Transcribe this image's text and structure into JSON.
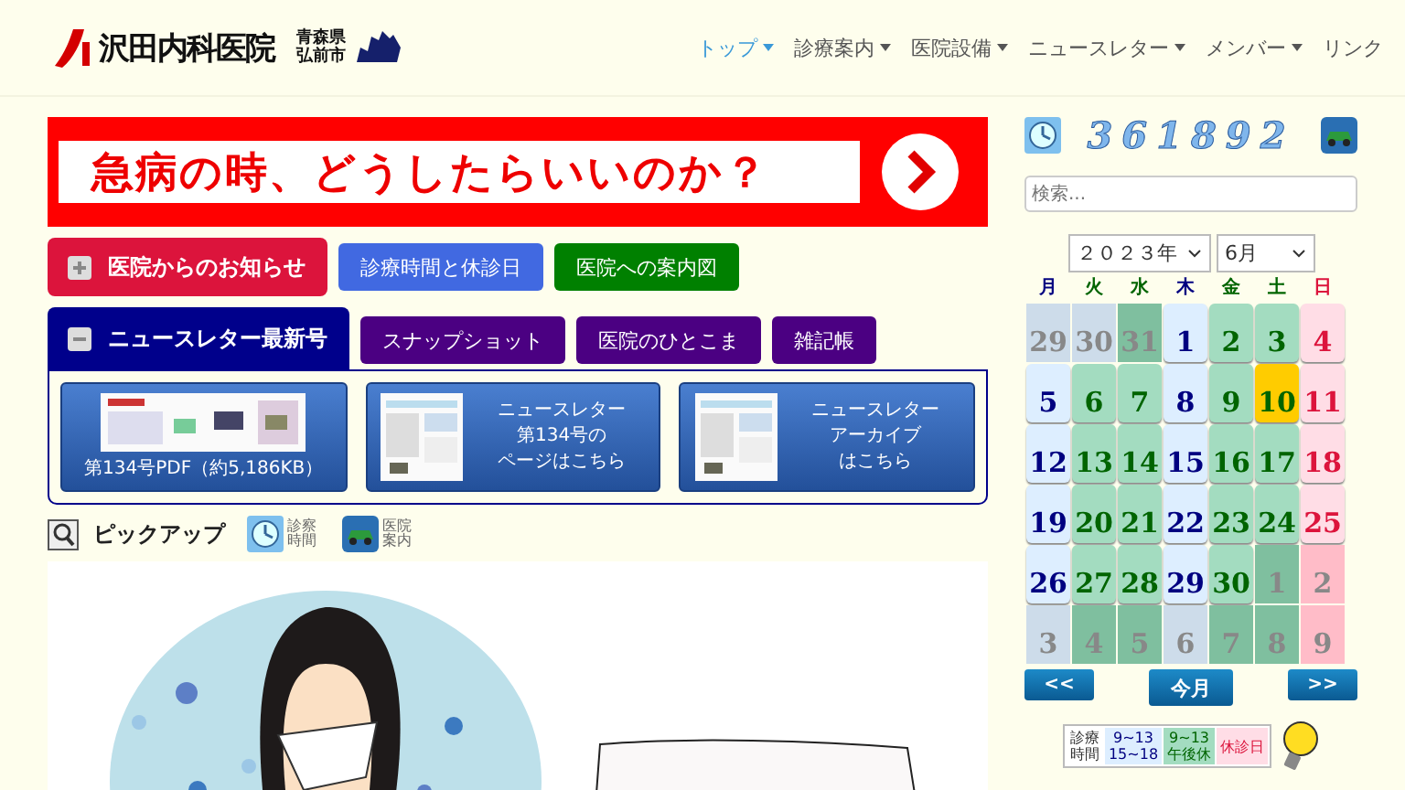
{
  "header": {
    "logo": "沢田内科医院",
    "region": [
      "青森県",
      "弘前市"
    ],
    "nav": [
      {
        "label": "トップ",
        "selected": true,
        "dropdown": true
      },
      {
        "label": "診療案内",
        "selected": false,
        "dropdown": true
      },
      {
        "label": "医院設備",
        "selected": false,
        "dropdown": true
      },
      {
        "label": "ニュースレター",
        "selected": false,
        "dropdown": true
      },
      {
        "label": "メンバー",
        "selected": false,
        "dropdown": true
      },
      {
        "label": "リンク",
        "selected": false,
        "dropdown": false
      }
    ]
  },
  "banner": {
    "text": "急病の時、どうしたらいいのか？"
  },
  "tab_groups": [
    {
      "main": {
        "label": "医院からのお知らせ",
        "expanded": false,
        "color": "#dc143c"
      },
      "links": [
        {
          "label": "診療時間と休診日",
          "color": "#4169e1"
        },
        {
          "label": "医院への案内図",
          "color": "#008000"
        }
      ]
    },
    {
      "main": {
        "label": "ニュースレター最新号",
        "expanded": true,
        "color": "#00008b"
      },
      "links": [
        {
          "label": "スナップショット",
          "color": "#4b0082"
        },
        {
          "label": "医院のひとこま",
          "color": "#4b0082"
        },
        {
          "label": "雑記帳",
          "color": "#4b0082"
        }
      ]
    }
  ],
  "newsletter": [
    {
      "kind": "wide",
      "lines": [
        "第134号PDF（約5,186KB）"
      ]
    },
    {
      "kind": "side",
      "lines": [
        "ニュースレター",
        "第134号の",
        "ページはこちら"
      ]
    },
    {
      "kind": "side",
      "lines": [
        "ニュースレター",
        "アーカイブ",
        "はこちら"
      ]
    }
  ],
  "pickup": {
    "title": "ピックアップ",
    "links": [
      {
        "kind": "clock",
        "lines": [
          "診察",
          "時間"
        ]
      },
      {
        "kind": "car",
        "lines": [
          "医院",
          "案内"
        ]
      }
    ]
  },
  "sidebar": {
    "counter": "361892",
    "search": {
      "placeholder": "検索..."
    },
    "year": "２０２３年",
    "month": "6月",
    "weekdays": [
      {
        "label": "月",
        "color": "#000080"
      },
      {
        "label": "火",
        "color": "#006400"
      },
      {
        "label": "水",
        "color": "#006400"
      },
      {
        "label": "木",
        "color": "#000080"
      },
      {
        "label": "金",
        "color": "#006400"
      },
      {
        "label": "土",
        "color": "#006400"
      },
      {
        "label": "日",
        "color": "#dc143c"
      }
    ],
    "days": [
      {
        "day": "29",
        "kind": "full",
        "other_month": true,
        "today": false
      },
      {
        "day": "30",
        "kind": "full",
        "other_month": true,
        "today": false
      },
      {
        "day": "31",
        "kind": "half",
        "other_month": true,
        "today": false
      },
      {
        "day": "1",
        "kind": "full",
        "other_month": false,
        "today": false
      },
      {
        "day": "2",
        "kind": "half",
        "other_month": false,
        "today": false
      },
      {
        "day": "3",
        "kind": "half",
        "other_month": false,
        "today": false
      },
      {
        "day": "4",
        "kind": "closed",
        "other_month": false,
        "today": false
      },
      {
        "day": "5",
        "kind": "full",
        "other_month": false,
        "today": false
      },
      {
        "day": "6",
        "kind": "half",
        "other_month": false,
        "today": false
      },
      {
        "day": "7",
        "kind": "half",
        "other_month": false,
        "today": false
      },
      {
        "day": "8",
        "kind": "full",
        "other_month": false,
        "today": false
      },
      {
        "day": "9",
        "kind": "half",
        "other_month": false,
        "today": false
      },
      {
        "day": "10",
        "kind": "half",
        "other_month": false,
        "today": true
      },
      {
        "day": "11",
        "kind": "closed",
        "other_month": false,
        "today": false
      },
      {
        "day": "12",
        "kind": "full",
        "other_month": false,
        "today": false
      },
      {
        "day": "13",
        "kind": "half",
        "other_month": false,
        "today": false
      },
      {
        "day": "14",
        "kind": "half",
        "other_month": false,
        "today": false
      },
      {
        "day": "15",
        "kind": "full",
        "other_month": false,
        "today": false
      },
      {
        "day": "16",
        "kind": "half",
        "other_month": false,
        "today": false
      },
      {
        "day": "17",
        "kind": "half",
        "other_month": false,
        "today": false
      },
      {
        "day": "18",
        "kind": "closed",
        "other_month": false,
        "today": false
      },
      {
        "day": "19",
        "kind": "full",
        "other_month": false,
        "today": false
      },
      {
        "day": "20",
        "kind": "half",
        "other_month": false,
        "today": false
      },
      {
        "day": "21",
        "kind": "half",
        "other_month": false,
        "today": false
      },
      {
        "day": "22",
        "kind": "full",
        "other_month": false,
        "today": false
      },
      {
        "day": "23",
        "kind": "half",
        "other_month": false,
        "today": false
      },
      {
        "day": "24",
        "kind": "half",
        "other_month": false,
        "today": false
      },
      {
        "day": "25",
        "kind": "closed",
        "other_month": false,
        "today": false
      },
      {
        "day": "26",
        "kind": "full",
        "other_month": false,
        "today": false
      },
      {
        "day": "27",
        "kind": "half",
        "other_month": false,
        "today": false
      },
      {
        "day": "28",
        "kind": "half",
        "other_month": false,
        "today": false
      },
      {
        "day": "29",
        "kind": "full",
        "other_month": false,
        "today": false
      },
      {
        "day": "30",
        "kind": "half",
        "other_month": false,
        "today": false
      },
      {
        "day": "1",
        "kind": "half",
        "other_month": true,
        "today": false
      },
      {
        "day": "2",
        "kind": "closed",
        "other_month": true,
        "today": false
      },
      {
        "day": "3",
        "kind": "full",
        "other_month": true,
        "today": false
      },
      {
        "day": "4",
        "kind": "half",
        "other_month": true,
        "today": false
      },
      {
        "day": "5",
        "kind": "half",
        "other_month": true,
        "today": false
      },
      {
        "day": "6",
        "kind": "full",
        "other_month": true,
        "today": false
      },
      {
        "day": "7",
        "kind": "half",
        "other_month": true,
        "today": false
      },
      {
        "day": "8",
        "kind": "half",
        "other_month": true,
        "today": false
      },
      {
        "day": "9",
        "kind": "closed",
        "other_month": true,
        "today": false
      }
    ],
    "calendar_nav": [
      "<<",
      "今月",
      ">>"
    ],
    "legend": {
      "title": [
        "診療",
        "時間"
      ],
      "items": [
        {
          "kind": "full",
          "lines": [
            "9~13",
            "15~18"
          ]
        },
        {
          "kind": "half",
          "lines": [
            "9~13",
            "午後休"
          ]
        },
        {
          "kind": "closed",
          "lines": [
            "休診日"
          ]
        }
      ]
    }
  }
}
